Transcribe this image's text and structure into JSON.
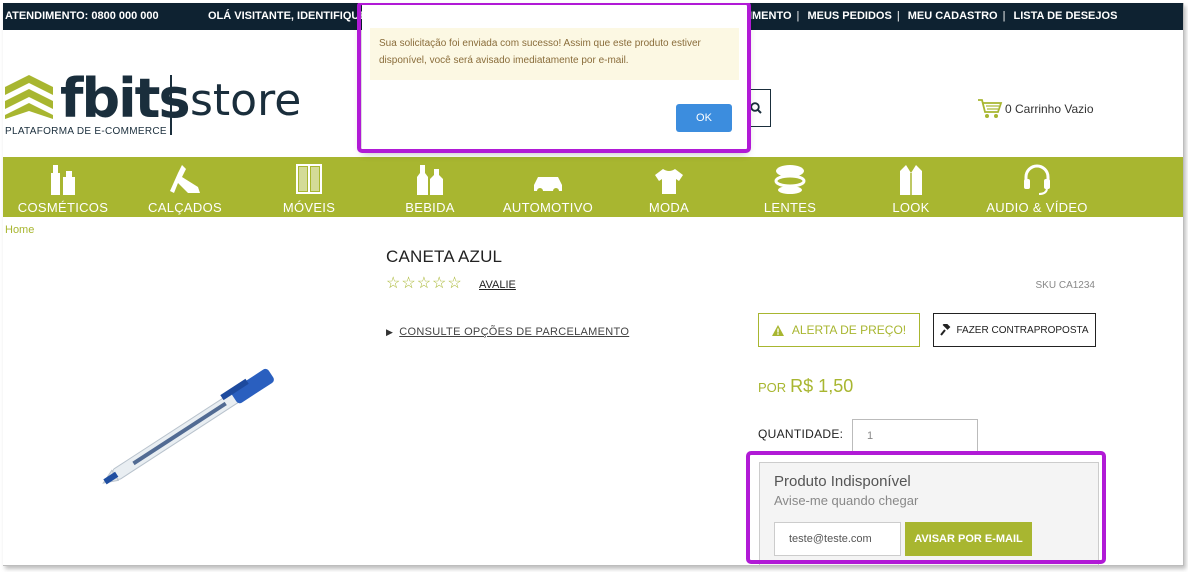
{
  "topbar": {
    "atendimento": "ATENDIMENTO: 0800 000 000",
    "greeting": "OLÁ VISITANTE, IDENTIFIQUE",
    "links": [
      "DIMENTO",
      "MEUS PEDIDOS",
      "MEU CADASTRO",
      "LISTA DE DESEJOS"
    ]
  },
  "logo": {
    "brand": "fbits",
    "store": "store",
    "tagline": "PLATAFORMA DE E-COMMERCE"
  },
  "cart": {
    "label": "0 Carrinho Vazio",
    "icon": "cart-icon"
  },
  "nav": [
    {
      "label": "COSMÉTICOS",
      "icon": "cosmetics-icon"
    },
    {
      "label": "CALÇADOS",
      "icon": "shoes-icon"
    },
    {
      "label": "MÓVEIS",
      "icon": "furniture-icon"
    },
    {
      "label": "BEBIDA",
      "icon": "bottles-icon"
    },
    {
      "label": "AUTOMOTIVO",
      "icon": "car-icon"
    },
    {
      "label": "MODA",
      "icon": "tshirt-icon"
    },
    {
      "label": "LENTES",
      "icon": "lens-icon"
    },
    {
      "label": "LOOK",
      "icon": "jacket-icon"
    },
    {
      "label": "AUDIO & VÍDEO",
      "icon": "headset-icon"
    }
  ],
  "breadcrumb": "Home",
  "product": {
    "title": "CANETA AZUL",
    "rating_stars": 5,
    "rating_filled": 0,
    "avalie": "AVALIE",
    "sku": "SKU CA1234",
    "parcelamento": "CONSULTE OPÇÕES DE PARCELAMENTO",
    "alert_button": "ALERTA DE PREÇO!",
    "offer_button": "FAZER CONTRAPROPOSTA",
    "price_prefix": "POR",
    "price": "R$ 1,50",
    "quantity_label": "QUANTIDADE:",
    "quantity_value": "1"
  },
  "unavailable": {
    "heading": "Produto Indisponível",
    "subheading": "Avise-me quando chegar",
    "email_value": "teste@teste.com",
    "notify_button": "AVISAR POR E-MAIL"
  },
  "modal": {
    "message": "Sua solicitação foi enviada com sucesso! Assim que este produto estiver disponível, você será avisado imediatamente por e-mail.",
    "ok_label": "OK"
  },
  "colors": {
    "accent": "#a8b630",
    "topbar": "#0e2231",
    "highlight": "#b11ad6",
    "ok_button": "#3c8dde"
  }
}
